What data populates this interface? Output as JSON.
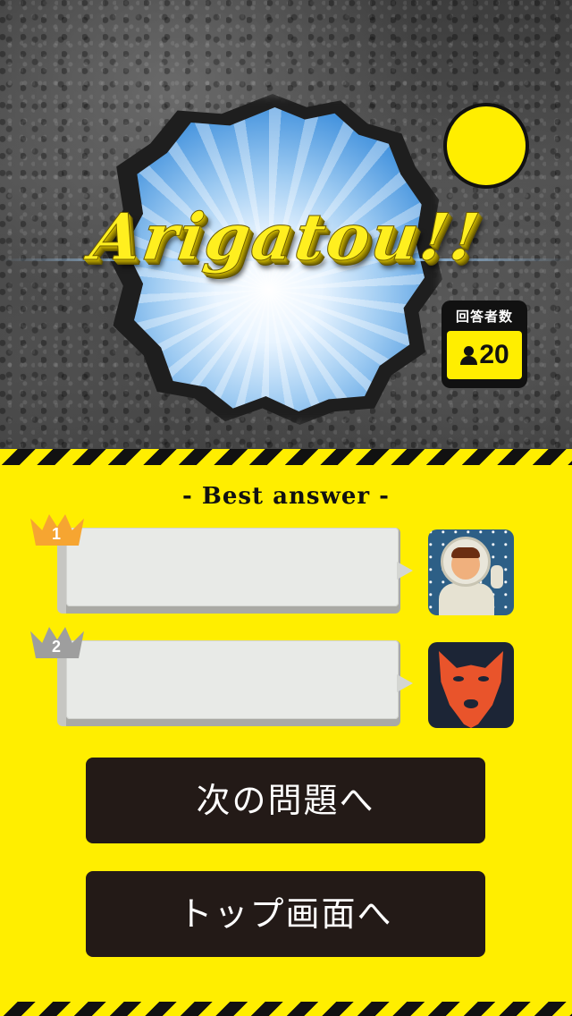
{
  "hero": {
    "title": "Arigatou!!",
    "responders_label": "回答者数",
    "responders_count": "20",
    "indicator_color": "#ffee00"
  },
  "panel": {
    "heading": "- Best answer -",
    "answers": [
      {
        "rank": "1",
        "crown": "gold",
        "text": "",
        "avatar": "astronaut-avatar"
      },
      {
        "rank": "2",
        "crown": "silver",
        "text": "",
        "avatar": "wolf-avatar"
      }
    ]
  },
  "buttons": {
    "next_question": "次の問題へ",
    "top_screen": "トップ画面へ"
  },
  "colors": {
    "accent_yellow": "#ffee00",
    "button_dark": "#231a17",
    "gold_crown": "#f6a531",
    "silver_crown": "#9e9e9e"
  }
}
